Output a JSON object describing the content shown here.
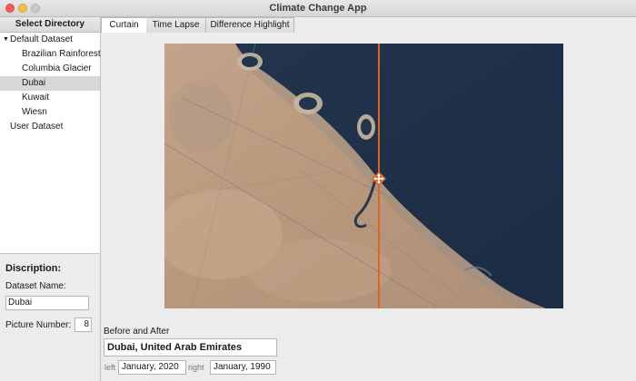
{
  "window": {
    "title": "Climate Change App"
  },
  "sidebar": {
    "header": "Select Directory",
    "tree": {
      "default_dataset": "Default Dataset",
      "items": [
        "Brazilian Rainforest",
        "Columbia Glacier",
        "Dubai",
        "Kuwait",
        "Wiesn"
      ],
      "selected_index": 2,
      "user_dataset": "User Dataset"
    }
  },
  "description": {
    "title": "Discription:",
    "name_label": "Dataset Name:",
    "name_value": "Dubai",
    "picture_label": "Picture Number:",
    "picture_value": "8"
  },
  "tabs": [
    "Curtain",
    "Time Lapse",
    "Difference Highlight"
  ],
  "active_tab": 0,
  "bottom": {
    "section_label": "Before and After",
    "location": "Dubai, United Arab Emirates",
    "left_label": "left",
    "left_value": "January, 2020",
    "right_label": "right",
    "right_value": "January, 1990"
  },
  "colors": {
    "curtain_line": "#e2631f",
    "sea": "#1f3149",
    "land": "#b89a7e"
  },
  "icons": {
    "curtain_handle": "move-arrows-icon"
  }
}
